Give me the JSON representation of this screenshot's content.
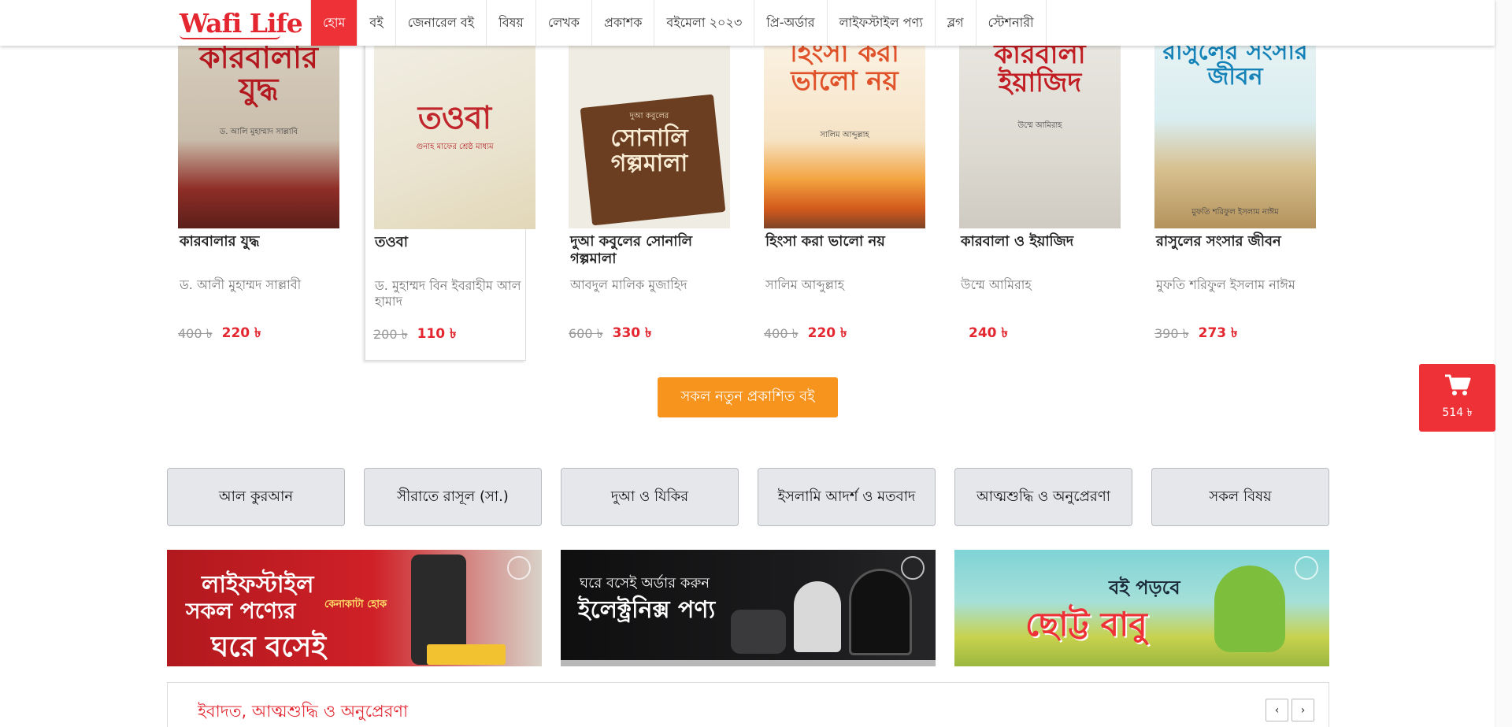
{
  "header": {
    "logo": "Wafi Life",
    "nav": [
      "হোম",
      "বই",
      "জেনারেল বই",
      "বিষয়",
      "লেখক",
      "প্রকাশক",
      "বইমেলা ২০২৩",
      "প্রি-অর্ডার",
      "লাইফস্টাইল পণ্য",
      "ব্লগ",
      "স্টেশনারী"
    ]
  },
  "books": [
    {
      "cover_title": "কারবালার যুদ্ধ",
      "cover_sub": "ড. আলি মুহাম্মাদ সাল্লাবি",
      "title": "কারবালার যুদ্ধ",
      "author": "ড. আলী মুহাম্মদ সাল্লাবী",
      "old_price": "400 ৳",
      "price": "220 ৳"
    },
    {
      "cover_title": "তওবা",
      "cover_sub": "গুনাহ মাফের শ্রেষ্ঠ মাধ্যম",
      "title": "তওবা",
      "author": "ড. মুহাম্মদ বিন ইবরাহীম আল হামাদ",
      "old_price": "200 ৳",
      "price": "110 ৳"
    },
    {
      "cover_title": "সোনালি গল্পমালা",
      "cover_sub": "দুআ কবুলের",
      "title": "দুআ কবুলের সোনালি গল্পমালা",
      "author": "আবদুল মালিক মুজাহিদ",
      "old_price": "600 ৳",
      "price": "330 ৳"
    },
    {
      "cover_title": "হিংসা করা ভালো নয়",
      "cover_sub": "সালিম আব্দুল্লাহ",
      "title": "হিংসা করা ভালো নয়",
      "author": "সালিম আব্দুল্লাহ",
      "old_price": "400 ৳",
      "price": "220 ৳"
    },
    {
      "cover_title": "কারবালা ইয়াজিদ",
      "cover_sub": "উম্মে আমিরাহ",
      "title": "কারবালা ও ইয়াজিদ",
      "author": "উম্মে আমিরাহ",
      "old_price": "",
      "price": "240 ৳"
    },
    {
      "cover_title": "রাসুলের সংসার জীবন",
      "cover_sub": "মুফতি শরিফুল ইসলাম নাঈম",
      "title": "রাসুলের সংসার জীবন",
      "author": "মুফতি শরিফুল ইসলাম নাঈম",
      "old_price": "390 ৳",
      "price": "273 ৳"
    }
  ],
  "all_new_button": "সকল নতুন প্রকাশিত বই",
  "cart": {
    "amount": "514 ৳"
  },
  "categories": [
    "আল কুরআন",
    "সীরাতে রাসূল (সা.)",
    "দুআ ও যিকির",
    "ইসলামি আদর্শ ও মতবাদ",
    "আত্মশুদ্ধি ও অনুপ্রেরণা",
    "সকল বিষয়"
  ],
  "banners": [
    {
      "lines": [
        "লাইফস্টাইল",
        "সকল পণ্যের",
        "কেনাকাটা হোক",
        "ঘরে বসেই"
      ]
    },
    {
      "lines": [
        "ঘরে বসেই অর্ডার করুন",
        "ইলেক্ট্রনিক্স পণ্য"
      ]
    },
    {
      "lines": [
        "বই পড়বে",
        "ছোট্ট বাবু"
      ]
    }
  ],
  "section": {
    "title": "ইবাদত, আত্মশুদ্ধি ও অনুপ্রেরণা",
    "prev": "‹",
    "next": "›"
  },
  "colors": {
    "brand_red": "#ee3137",
    "price_red": "#e3262f",
    "orange": "#f7941e"
  }
}
